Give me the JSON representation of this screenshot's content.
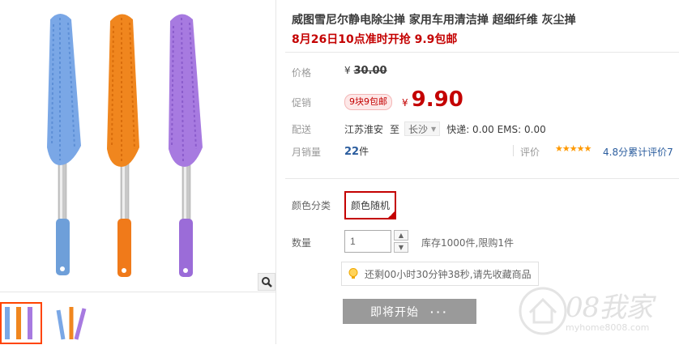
{
  "product": {
    "title": "威图雪尼尔静电除尘掸 家用车用清洁掸 超细纤维 灰尘掸",
    "subtitle": "8月26日10点准时开抢 9.9包邮"
  },
  "price": {
    "label": "价格",
    "currency": "¥",
    "original": "30.00"
  },
  "promo": {
    "label": "促销",
    "badge": "9块9包邮",
    "currency": "¥",
    "price": "9.90"
  },
  "delivery": {
    "label": "配送",
    "from": "江苏淮安",
    "to_word": "至",
    "city": "长沙",
    "fees": "快递: 0.00 EMS: 0.00"
  },
  "sales": {
    "label": "月销量",
    "count": "22",
    "unit": "件",
    "rating_label": "评价",
    "stars": "★★★★★",
    "rating_text": "4.8分累计评价7"
  },
  "sku": {
    "label": "颜色分类",
    "option": "颜色随机"
  },
  "quantity": {
    "label": "数量",
    "value": "1",
    "stock": "库存1000件,限购1件"
  },
  "notice": {
    "text": "还剩00小时30分钟38秒,请先收藏商品"
  },
  "button": {
    "label": "即将开始",
    "dots": "···"
  },
  "watermark": {
    "brand": "08我家",
    "url": "myhome8008.com"
  },
  "colors": {
    "accent": "#c40000",
    "blue_duster": "#7aa7e6",
    "orange_duster": "#f0861e",
    "purple_duster": "#a77ae0"
  }
}
